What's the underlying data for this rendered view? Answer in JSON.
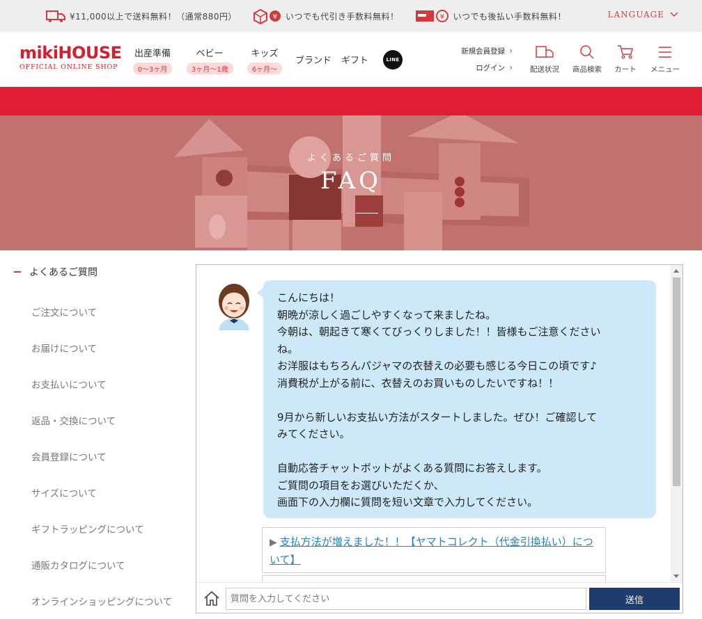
{
  "topbar": {
    "promos": [
      {
        "icon": "truck-icon",
        "text": "¥11,000以上で送料無料！（通常880円）"
      },
      {
        "icon": "box-yen-icon",
        "text": "いつでも代引き手数料無料！"
      },
      {
        "icon": "card-yen-icon",
        "text": "いつでも後払い手数料無料！"
      }
    ],
    "language": "LANGUAGE"
  },
  "header": {
    "logo_mark": "mikiHOUSE",
    "logo_sub": "OFFICIAL ONLINE SHOP",
    "nav": [
      {
        "label": "出産準備",
        "pill": "0〜3ヶ月"
      },
      {
        "label": "ベビー",
        "pill": "3ヶ月〜1歳"
      },
      {
        "label": "キッズ",
        "pill": "6ヶ月〜"
      }
    ],
    "nav_plain": [
      "ブランド",
      "ギフト"
    ],
    "line_label": "LINE",
    "register": "新規会員登録",
    "login": "ログイン",
    "icons": [
      {
        "label": "配送状況",
        "icon": "delivery-icon"
      },
      {
        "label": "商品検索",
        "icon": "search-icon"
      },
      {
        "label": "カート",
        "icon": "cart-icon"
      },
      {
        "label": "メニュー",
        "icon": "menu-icon"
      }
    ]
  },
  "hero": {
    "kicker": "よくあるご質問",
    "title": "FAQ"
  },
  "sidebar": {
    "heading": "よくあるご質問",
    "items": [
      "ご注文について",
      "お届けについて",
      "お支払いについて",
      "返品・交換について",
      "会員登録について",
      "サイズについて",
      "ギフトラッピングについて",
      "通販カタログについて",
      "オンラインショッピングについて"
    ]
  },
  "chat": {
    "message_lines": [
      "こんにちは！",
      "朝晩が涼しく過ごしやすくなって来ましたね。",
      "今朝は、朝起きて寒くてびっくりしました！！皆様もご注意ください",
      "ね。",
      "お洋服はもちろんパジャマの衣替えの必要も感じる今日この頃です♪",
      "消費税が上がる前に、衣替えのお買いものしたいですね！！",
      "",
      "9月から新しいお支払い方法がスタートしました。ぜひ！ご確認して",
      "みてください。",
      "",
      "自動応答チャットボットがよくある質問にお答えします。",
      "ご質問の項目をお選びいただくか、",
      "画面下の入力欄に質問を短い文章で入力してください。"
    ],
    "link_text": "支払方法が増えました！！【ヤマトコレクト（代金引換払い）について】",
    "input_placeholder": "質問を入力してください",
    "send_label": "送信"
  },
  "colors": {
    "brand_red": "#e01e33",
    "bubble_blue": "#cde8f8",
    "send_navy": "#1f3c6e",
    "link_blue": "#2a7fc0"
  }
}
